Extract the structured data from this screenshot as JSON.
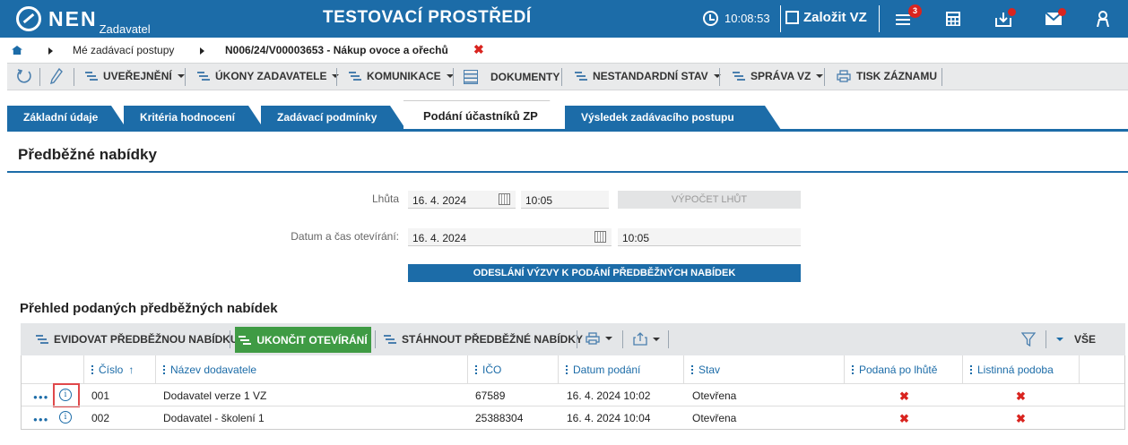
{
  "app": {
    "logo": "NEN",
    "logo_sub": "Zadavatel",
    "environment": "TESTOVACÍ PROSTŘEDÍ",
    "time": "10:08:53",
    "create_label": "Založit VZ",
    "notification_count": "3"
  },
  "breadcrumb": {
    "items": [
      "Mé zadávací postupy",
      "N006/24/V00003653 - Nákup ovoce a ořechů"
    ],
    "close_symbol": "✖"
  },
  "toolbar": {
    "items": [
      "UVEŘEJNĚNÍ",
      "ÚKONY ZADAVATELE",
      "KOMUNIKACE",
      "DOKUMENTY",
      "NESTANDARDNÍ STAV",
      "SPRÁVA VZ",
      "TISK ZÁZNAMU"
    ]
  },
  "tabs": [
    {
      "label": "Základní údaje",
      "active": false
    },
    {
      "label": "Kritéria hodnocení",
      "active": false
    },
    {
      "label": "Zadávací podmínky",
      "active": false
    },
    {
      "label": "Podání účastníků ZP",
      "active": true
    },
    {
      "label": "Výsledek zadávacího postupu",
      "active": false
    }
  ],
  "section": {
    "title": "Předběžné nabídky"
  },
  "form": {
    "deadline_label": "Lhůta",
    "deadline_date": "16. 4. 2024",
    "deadline_time": "10:05",
    "calc_button": "VÝPOČET LHŮT",
    "opening_label": "Datum a čas otevírání:",
    "opening_date": "16. 4. 2024",
    "opening_time": "10:05",
    "send_button": "ODESLÁNÍ VÝZVY K PODÁNÍ PŘEDBĚŽNÝCH NABÍDEK"
  },
  "grid": {
    "title": "Přehled podaných předběžných nabídek",
    "toolbar": {
      "record": "EVIDOVAT PŘEDBĚŽNOU NABÍDKU",
      "finish": "UKONČIT OTEVÍRÁNÍ",
      "download": "STÁHNOUT PŘEDBĚŽNÉ NABÍDKY",
      "all": "VŠE"
    },
    "columns": [
      "Číslo",
      "Název dodavatele",
      "IČO",
      "Datum podání",
      "Stav",
      "Podaná po lhůtě",
      "Listinná podoba"
    ],
    "sort_symbol": "↑",
    "rows": [
      {
        "cislo": "001",
        "nazev": "Dodavatel verze 1 VZ",
        "ico": "67589",
        "datum": "16. 4. 2024 10:02",
        "stav": "Otevřena",
        "po_lhute": "✖",
        "listinna": "✖"
      },
      {
        "cislo": "002",
        "nazev": "Dodavatel - školení 1",
        "ico": "25388304",
        "datum": "16. 4. 2024 10:04",
        "stav": "Otevřena",
        "po_lhute": "✖",
        "listinna": "✖"
      }
    ]
  },
  "colors": {
    "primary": "#1c6ca8",
    "accent_green": "#3f9b44",
    "alert_red": "#d9241f"
  }
}
